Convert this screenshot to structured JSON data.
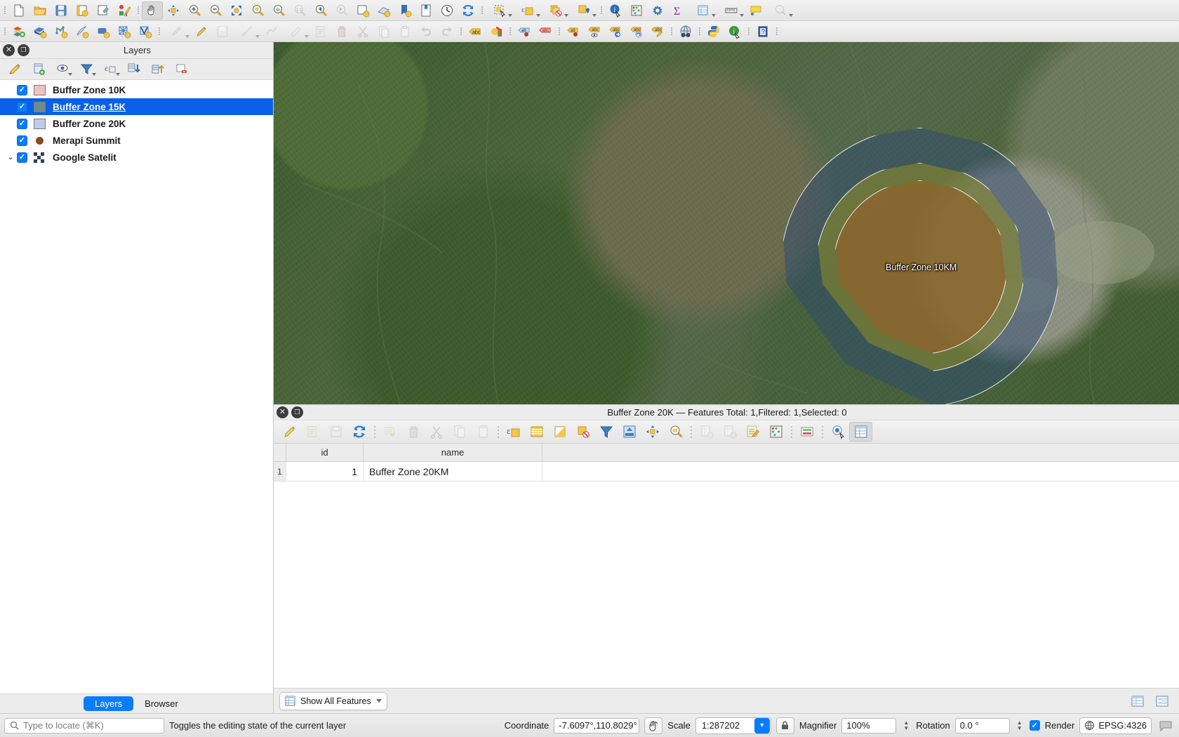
{
  "app": {
    "title": "QGIS"
  },
  "toolbar_top": {
    "groups": [
      {
        "name": "project",
        "buttons": [
          {
            "name": "new-project-button",
            "icon": "new-document-icon",
            "label": "New Project"
          },
          {
            "name": "open-project-button",
            "icon": "open-folder-icon",
            "label": "Open Project"
          },
          {
            "name": "save-project-button",
            "icon": "save-disk-icon",
            "label": "Save Project"
          },
          {
            "name": "new-print-layout-button",
            "icon": "print-layout-icon",
            "label": "New Print Layout"
          },
          {
            "name": "style-manager-button",
            "icon": "style-manager-icon",
            "label": "Style Manager"
          },
          {
            "name": "annotations-button",
            "icon": "annotation-icon",
            "label": "Annotations"
          }
        ]
      },
      {
        "name": "map-navigation",
        "buttons": [
          {
            "name": "pan-map-button",
            "icon": "hand-pan-icon",
            "label": "Pan Map",
            "active": true
          },
          {
            "name": "pan-to-selection-button",
            "icon": "pan-selection-icon",
            "label": "Pan Map to Selection"
          },
          {
            "name": "zoom-in-button",
            "icon": "zoom-in-icon",
            "label": "Zoom In"
          },
          {
            "name": "zoom-out-button",
            "icon": "zoom-out-icon",
            "label": "Zoom Out"
          },
          {
            "name": "zoom-full-button",
            "icon": "zoom-full-icon",
            "label": "Zoom Full"
          },
          {
            "name": "zoom-selection-button",
            "icon": "zoom-selection-icon",
            "label": "Zoom to Selection"
          },
          {
            "name": "zoom-layer-button",
            "icon": "zoom-layer-icon",
            "label": "Zoom to Layer"
          },
          {
            "name": "zoom-native-button",
            "icon": "zoom-native-icon",
            "label": "Zoom to Native Resolution"
          },
          {
            "name": "zoom-last-button",
            "icon": "zoom-last-icon",
            "label": "Zoom Last"
          },
          {
            "name": "zoom-next-button",
            "icon": "zoom-next-icon",
            "label": "Zoom Next"
          },
          {
            "name": "new-map-view-button",
            "icon": "new-map-view-icon",
            "label": "New Map View"
          },
          {
            "name": "new-3d-map-view-button",
            "icon": "map-3d-icon",
            "label": "New 3D Map View"
          },
          {
            "name": "new-bookmark-button",
            "icon": "bookmark-add-icon",
            "label": "New Spatial Bookmark"
          },
          {
            "name": "show-bookmarks-button",
            "icon": "bookmark-list-icon",
            "label": "Show Spatial Bookmarks"
          },
          {
            "name": "temporal-controller-button",
            "icon": "clock-icon",
            "label": "Temporal Controller"
          },
          {
            "name": "refresh-button",
            "icon": "refresh-icon",
            "label": "Refresh"
          }
        ]
      },
      {
        "name": "attributes",
        "buttons": [
          {
            "name": "select-features-button",
            "icon": "select-rectangle-icon",
            "label": "Select Features",
            "menu": true
          },
          {
            "name": "select-by-expression-button",
            "icon": "select-expression-icon",
            "label": "Select by Expression",
            "menu": true
          },
          {
            "name": "deselect-features-button",
            "icon": "deselect-icon",
            "label": "Deselect Features",
            "menu": true
          },
          {
            "name": "select-value-button",
            "icon": "select-value-icon",
            "label": "Select Value",
            "menu": true
          }
        ]
      },
      {
        "name": "info",
        "buttons": [
          {
            "name": "identify-features-button",
            "icon": "identify-icon",
            "label": "Identify Features"
          },
          {
            "name": "measure-button",
            "icon": "abacus-icon",
            "label": "Measure"
          },
          {
            "name": "processing-toolbox-button",
            "icon": "gear-icon",
            "label": "Processing Toolbox"
          },
          {
            "name": "statistical-summary-button",
            "icon": "sigma-icon",
            "label": "Statistical Summary"
          },
          {
            "name": "open-attribute-table-button",
            "icon": "attribute-table-icon",
            "label": "Open Attribute Table",
            "menu": true
          },
          {
            "name": "measure-line-button",
            "icon": "ruler-icon",
            "label": "Measure Line",
            "menu": true
          },
          {
            "name": "map-tips-button",
            "icon": "map-tips-icon",
            "label": "Show Map Tips"
          },
          {
            "name": "run-feature-action-button",
            "icon": "feature-action-icon",
            "label": "Run Feature Action",
            "menu": true,
            "disabled": true
          }
        ]
      }
    ]
  },
  "toolbar_second": {
    "groups": [
      {
        "name": "data-source",
        "buttons": [
          {
            "name": "open-data-source-manager-button",
            "icon": "data-source-manager-icon",
            "label": "Open Data Source Manager"
          },
          {
            "name": "add-vector-layer-button",
            "icon": "add-vector-layer-icon",
            "label": "Add Vector Layer"
          },
          {
            "name": "add-raster-layer-button",
            "icon": "add-raster-layer-icon",
            "label": "Add Raster Layer"
          },
          {
            "name": "add-delimited-text-layer-button",
            "icon": "add-delimited-text-icon",
            "label": "Add Delimited Text Layer"
          },
          {
            "name": "add-postgis-layer-button",
            "icon": "add-postgis-icon",
            "label": "Add PostGIS Layer"
          },
          {
            "name": "add-mesh-layer-button",
            "icon": "add-mesh-layer-icon",
            "label": "Add Mesh Layer"
          },
          {
            "name": "add-virtual-layer-button",
            "icon": "add-virtual-layer-icon",
            "label": "Add Virtual Layer"
          }
        ]
      },
      {
        "name": "digitizing",
        "buttons": [
          {
            "name": "current-edits-button",
            "icon": "current-edits-icon",
            "label": "Current Edits",
            "menu": true,
            "disabled": true
          },
          {
            "name": "toggle-editing-button",
            "icon": "pencil-icon",
            "label": "Toggle Editing"
          },
          {
            "name": "save-layer-edits-button",
            "icon": "save-edits-icon",
            "label": "Save Layer Edits",
            "disabled": true
          },
          {
            "name": "add-line-feature-button",
            "icon": "add-line-icon",
            "label": "Add Line Feature",
            "menu": true,
            "disabled": true
          },
          {
            "name": "vertex-tool-button",
            "icon": "vertex-tool-icon",
            "label": "Vertex Tool",
            "disabled": true
          },
          {
            "name": "modify-attributes-button",
            "icon": "multi-edit-icon",
            "label": "Modify Attributes of Selected Features",
            "disabled": true
          },
          {
            "name": "delete-selected-button",
            "icon": "trash-icon",
            "label": "Delete Selected",
            "disabled": true
          },
          {
            "name": "cut-features-button",
            "icon": "scissors-icon",
            "label": "Cut Features",
            "disabled": true
          },
          {
            "name": "copy-features-button",
            "icon": "copy-icon",
            "label": "Copy Features",
            "disabled": true
          },
          {
            "name": "paste-features-button",
            "icon": "paste-icon",
            "label": "Paste Features",
            "disabled": true
          },
          {
            "name": "undo-button",
            "icon": "undo-arrow-icon",
            "label": "Undo",
            "disabled": true
          },
          {
            "name": "redo-button",
            "icon": "redo-arrow-icon",
            "label": "Redo",
            "disabled": true
          }
        ]
      },
      {
        "name": "labels",
        "buttons": [
          {
            "name": "layer-labeling-options-button",
            "icon": "label-icon",
            "label": "Layer Labeling Options"
          },
          {
            "name": "layer-diagram-options-button",
            "icon": "diagram-icon",
            "label": "Layer Diagram Options"
          },
          {
            "name": "highlight-pinned-labels-button",
            "icon": "pin-label-icon",
            "label": "Highlight Pinned Labels"
          },
          {
            "name": "toggle-display-unplaced-labels-button",
            "icon": "unplaced-label-icon",
            "label": "Toggle Display of Unplaced Labels"
          },
          {
            "name": "pin-labels-button",
            "icon": "pin-labels-icon",
            "label": "Pin/Unpin Labels and Diagrams"
          },
          {
            "name": "show-hide-labels-button",
            "icon": "show-hide-label-icon",
            "label": "Show/Hide Labels and Diagrams"
          },
          {
            "name": "move-label-button",
            "icon": "move-label-icon",
            "label": "Move a Label, Diagram or Callout"
          },
          {
            "name": "rotate-label-button",
            "icon": "rotate-label-icon",
            "label": "Rotate a Label"
          },
          {
            "name": "change-label-button",
            "icon": "change-label-icon",
            "label": "Change Label Properties"
          }
        ]
      },
      {
        "name": "web",
        "buttons": [
          {
            "name": "metasearch-button",
            "icon": "globe-binoculars-icon",
            "label": "MetaSearch"
          }
        ]
      },
      {
        "name": "plugins",
        "buttons": [
          {
            "name": "python-console-button",
            "icon": "python-icon",
            "label": "Python Console"
          },
          {
            "name": "about-button",
            "icon": "info-icon",
            "label": "About"
          }
        ]
      },
      {
        "name": "help",
        "buttons": [
          {
            "name": "help-contents-button",
            "icon": "help-book-icon",
            "label": "Help Contents"
          }
        ]
      }
    ]
  },
  "layers_panel": {
    "title": "Layers",
    "close_label": "Close",
    "undock_label": "Undock",
    "toolbar": [
      {
        "name": "open-layer-styling-panel-button",
        "icon": "paintbrush-icon",
        "label": "Open the Layer Styling panel"
      },
      {
        "name": "add-group-button",
        "icon": "add-group-icon",
        "label": "Add Group"
      },
      {
        "name": "manage-map-themes-button",
        "icon": "eye-icon",
        "label": "Manage Map Themes",
        "menu": true
      },
      {
        "name": "filter-legend-button",
        "icon": "filter-funnel-icon",
        "label": "Filter Legend",
        "menu": true
      },
      {
        "name": "filter-legend-expression-button",
        "icon": "expression-filter-icon",
        "label": "Filter Legend by Expression",
        "menu": true
      },
      {
        "name": "expand-all-button",
        "icon": "expand-all-icon",
        "label": "Expand All"
      },
      {
        "name": "collapse-all-button",
        "icon": "collapse-all-icon",
        "label": "Collapse All"
      },
      {
        "name": "remove-layer-button",
        "icon": "remove-layer-icon",
        "label": "Remove Layer/Group"
      }
    ],
    "items": [
      {
        "name": "layer-item-buffer-zone-10k",
        "label": "Buffer Zone 10K",
        "checked": true,
        "selected": false,
        "swatch": "#efc2c2",
        "swatch_type": "polygon",
        "expandable": false
      },
      {
        "name": "layer-item-buffer-zone-15k",
        "label": "Buffer Zone 15K",
        "checked": true,
        "selected": true,
        "swatch": "#6d8d8d",
        "swatch_type": "polygon",
        "expandable": false
      },
      {
        "name": "layer-item-buffer-zone-20k",
        "label": "Buffer Zone 20K",
        "checked": true,
        "selected": false,
        "swatch": "#c2cbe8",
        "swatch_type": "polygon",
        "expandable": false
      },
      {
        "name": "layer-item-merapi-summit",
        "label": "Merapi Summit",
        "checked": true,
        "selected": false,
        "swatch": "#8b4a19",
        "swatch_type": "point",
        "expandable": false
      },
      {
        "name": "layer-item-google-satelit",
        "label": "Google Satelit",
        "checked": true,
        "selected": false,
        "swatch": "#4a5a7a",
        "swatch_type": "raster",
        "expandable": true
      }
    ],
    "tabs": [
      {
        "name": "panel-tab-layers",
        "label": "Layers",
        "active": true
      },
      {
        "name": "panel-tab-browser",
        "label": "Browser",
        "active": false
      }
    ]
  },
  "map": {
    "feature_label": "Buffer Zone 10KM",
    "zones": [
      {
        "name": "map-zone-20k",
        "label": "Buffer Zone 20K",
        "fill": "rgba(40,70,120,.44)"
      },
      {
        "name": "map-zone-15k",
        "label": "Buffer Zone 15K",
        "fill": "rgba(140,140,40,.58)"
      },
      {
        "name": "map-zone-10k",
        "label": "Buffer Zone 10K",
        "fill": "rgba(150,95,40,.62)"
      }
    ],
    "cursor": "hand-pan-cursor"
  },
  "attribute_table": {
    "title": "Buffer Zone 20K — Features Total: 1,Filtered: 1,Selected: 0",
    "layer_name": "Buffer Zone 20K",
    "features_total": "1",
    "features_filtered": "1",
    "features_selected": "0",
    "toolbar": [
      {
        "name": "toggle-editing-mode-button",
        "icon": "pencil-icon",
        "label": "Toggle Editing Mode"
      },
      {
        "name": "multi-edit-button",
        "icon": "multi-edit-icon",
        "label": "Toggle Multi Edit Mode",
        "disabled": true
      },
      {
        "name": "save-edits-button",
        "icon": "save-edits-icon",
        "label": "Save Edits",
        "disabled": true
      },
      {
        "name": "reload-table-button",
        "icon": "refresh-icon",
        "label": "Reload the Table"
      },
      {
        "name": "add-feature-button",
        "icon": "add-feature-icon",
        "label": "Add Feature",
        "disabled": true
      },
      {
        "name": "delete-selected-features-button",
        "icon": "trash-icon",
        "label": "Delete Selected Features",
        "disabled": true
      },
      {
        "name": "cut-selected-button",
        "icon": "scissors-icon",
        "label": "Cut Selected Rows to Clipboard",
        "disabled": true
      },
      {
        "name": "copy-selected-button",
        "icon": "copy-icon",
        "label": "Copy Selected Rows to Clipboard",
        "disabled": true
      },
      {
        "name": "paste-features-button",
        "icon": "paste-icon",
        "label": "Paste Features from Clipboard",
        "disabled": true
      },
      {
        "name": "select-by-expression-button",
        "icon": "select-expression-icon",
        "label": "Select Features Using an Expression"
      },
      {
        "name": "select-all-button",
        "icon": "select-all-icon",
        "label": "Select All"
      },
      {
        "name": "invert-selection-button",
        "icon": "invert-selection-icon",
        "label": "Invert Selection"
      },
      {
        "name": "deselect-all-button",
        "icon": "deselect-icon",
        "label": "Deselect All"
      },
      {
        "name": "filter-selection-button",
        "icon": "filter-funnel-icon",
        "label": "Filter/Select Features Using Form"
      },
      {
        "name": "move-selection-to-top-button",
        "icon": "move-to-top-icon",
        "label": "Move Selection to Top"
      },
      {
        "name": "pan-to-selected-button",
        "icon": "pan-selection-icon",
        "label": "Pan Map to the Selected Rows"
      },
      {
        "name": "zoom-to-selected-button",
        "icon": "zoom-selection-icon",
        "label": "Zoom Map to the Selected Rows"
      },
      {
        "name": "new-field-button",
        "icon": "new-field-icon",
        "label": "New Field",
        "disabled": true
      },
      {
        "name": "delete-field-button",
        "icon": "delete-field-icon",
        "label": "Delete Field",
        "disabled": true
      },
      {
        "name": "open-field-calculator-button",
        "icon": "field-calculator-icon",
        "label": "Open Field Calculator"
      },
      {
        "name": "conditional-formatting-button",
        "icon": "abacus-icon",
        "label": "Conditional Formatting"
      },
      {
        "name": "organize-columns-button",
        "icon": "organize-columns-icon",
        "label": "Organize Columns"
      },
      {
        "name": "actions-button",
        "icon": "actions-icon",
        "label": "Actions"
      },
      {
        "name": "toggle-form-view-button",
        "icon": "form-view-icon",
        "label": "Switch to Form View",
        "active": true
      }
    ],
    "columns": [
      {
        "name": "attr-column-id",
        "label": "id"
      },
      {
        "name": "attr-column-name",
        "label": "name"
      }
    ],
    "rows": [
      {
        "index": "1",
        "id": "1",
        "name": "Buffer Zone 20KM"
      }
    ],
    "footer": {
      "filter_label": "Show All Features",
      "filter_icon": "table-filter-icon",
      "view_buttons": [
        {
          "name": "table-view-button",
          "icon": "table-view-icon",
          "label": "Table View",
          "active": true
        },
        {
          "name": "form-view-button",
          "icon": "form-view-icon",
          "label": "Form View",
          "active": false
        }
      ]
    }
  },
  "status_bar": {
    "locate_placeholder": "Type to locate (⌘K)",
    "locate_icon": "search-icon",
    "message": "Toggles the editing state of the current layer",
    "coordinate_label": "Coordinate",
    "coordinate_value": "-7.6097°,110.8029°",
    "coordinate_toggle_icon": "coordinate-capture-icon",
    "scale_label": "Scale",
    "scale_value": "1:287202",
    "lock_icon": "lock-scale-icon",
    "magnifier_label": "Magnifier",
    "magnifier_value": "100%",
    "rotation_label": "Rotation",
    "rotation_value": "0.0 °",
    "render_label": "Render",
    "render_checked": true,
    "crs_label": "EPSG:4326",
    "crs_icon": "globe-icon",
    "messages_icon": "message-log-icon"
  },
  "colors": {
    "accent": "#0a7cff",
    "selection": "#0a60e8",
    "toolbar_bg": "#ececec"
  }
}
